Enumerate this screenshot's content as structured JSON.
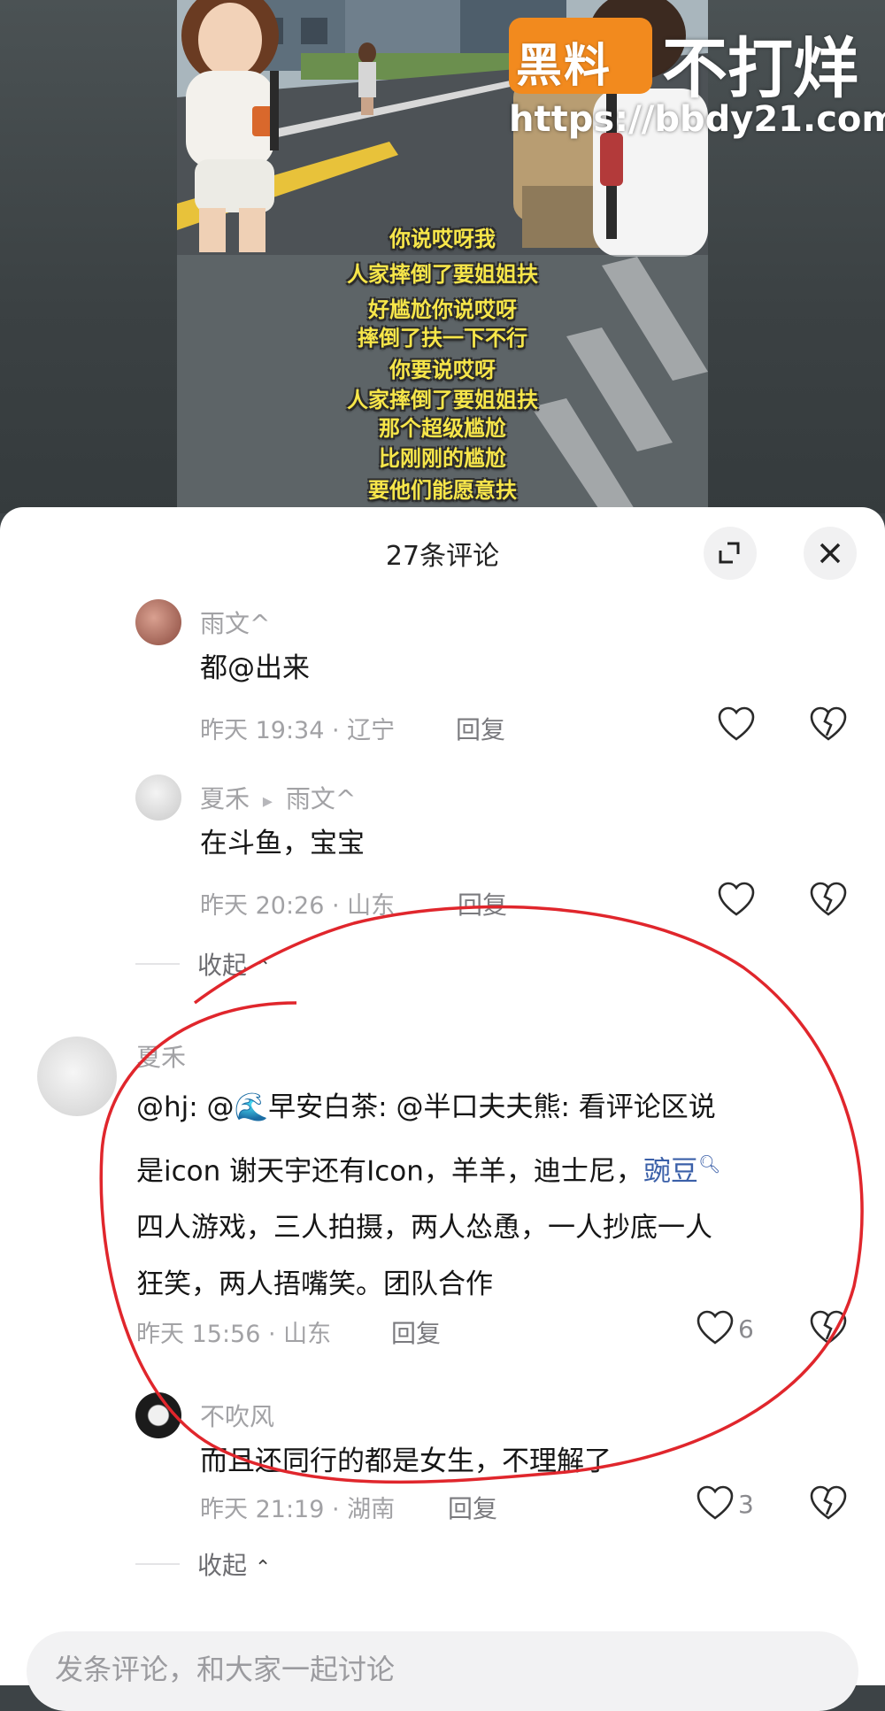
{
  "video": {
    "subtitles": [
      "你说哎呀我",
      "人家摔倒了要姐姐扶",
      "好尴尬你说哎呀",
      "摔倒了扶一下不行",
      "你要说哎呀",
      "人家摔倒了要姐姐扶",
      "那个超级尴尬",
      "比刚刚的尴尬",
      "要他们能愿意扶"
    ],
    "watermark": {
      "logo_text": "黑料",
      "brand_text": "不打烊",
      "url": "https://bbdy21.com"
    }
  },
  "sheet": {
    "title": "27条评论",
    "expand_icon": "expand-icon",
    "close_icon": "close-icon"
  },
  "comments": [
    {
      "username": "雨文^",
      "text": "都@出来",
      "time_location": "昨天 19:34 · 辽宁",
      "reply_label": "回复"
    },
    {
      "username": "夏禾",
      "reply_arrow": "▸",
      "reply_to": "雨文^",
      "text": "在斗鱼，宝宝",
      "time_location": "昨天 20:26 · 山东",
      "reply_label": "回复"
    },
    {
      "username": "夏禾",
      "text_part1": "@hj: @",
      "text_emoji": "🌊",
      "text_part2": "早安白茶: @半口夫夫熊: 看评论区说",
      "line2_part1": "是icon 谢天宇还有Icon，羊羊，迪士尼，",
      "line2_link": "豌豆",
      "line3": "四人游戏，三人拍摄，两人怂恿，一人抄底一人",
      "line4": "狂笑，两人捂嘴笑。团队合作",
      "time_location": "昨天 15:56 · 山东",
      "reply_label": "回复",
      "likes": "6"
    },
    {
      "username": "不吹风",
      "text": "而且还同行的都是女生，不理解了",
      "time_location": "昨天 21:19 · 湖南",
      "reply_label": "回复",
      "likes": "3"
    }
  ],
  "collapse_label": "收起",
  "input_placeholder": "发条评论，和大家一起讨论",
  "colors": {
    "annotation_red": "#e0262c",
    "link_blue": "#3a5fa8",
    "watermark_orange": "#f28a1e"
  }
}
